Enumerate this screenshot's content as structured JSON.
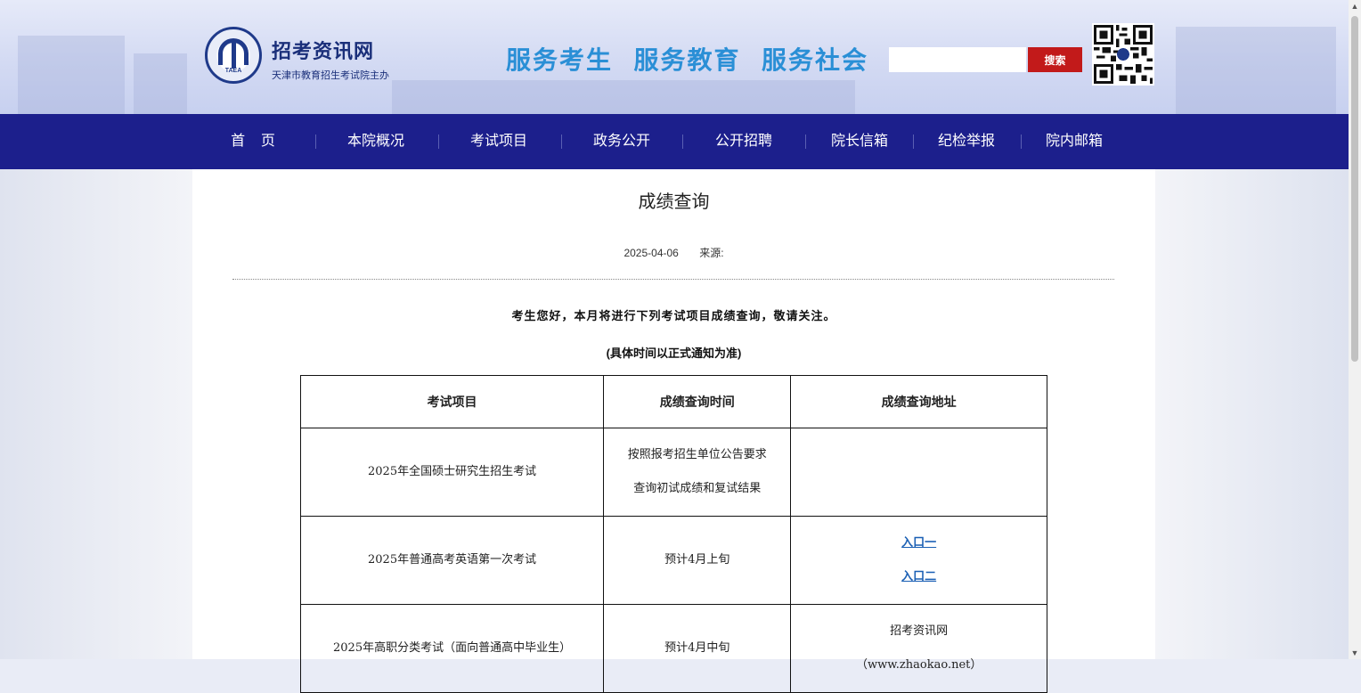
{
  "header": {
    "logo_text": "TAEA",
    "site_name": "招考资讯网",
    "site_subtitle": "天津市教育招生考试院主办",
    "slogan": "服务考生  服务教育  服务社会",
    "search": {
      "placeholder": "",
      "value": "",
      "button_label": "搜索"
    }
  },
  "nav": {
    "items": [
      {
        "label": "首    页"
      },
      {
        "label": "本院概况"
      },
      {
        "label": "考试项目"
      },
      {
        "label": "政务公开"
      },
      {
        "label": "公开招聘"
      },
      {
        "label": "院长信箱"
      },
      {
        "label": "纪检举报"
      },
      {
        "label": "院内邮箱"
      }
    ]
  },
  "article": {
    "title": "成绩查询",
    "date": "2025-04-06",
    "source_label": "来源:",
    "intro": "考生您好，本月将进行下列考试项目成绩查询，敬请关注。",
    "note": "(具体时间以正式通知为准)",
    "table": {
      "headers": [
        "考试项目",
        "成绩查询时间",
        "成绩查询地址"
      ],
      "rows": [
        {
          "project": "2025年全国硕士研究生招生考试",
          "time_line1": "按照报考招生单位公告要求",
          "time_line2": "查询初试成绩和复试结果"
        },
        {
          "project": "2025年普通高考英语第一次考试",
          "time_line1": "预计4月上旬",
          "link1": "入口一",
          "link2": "入口二"
        },
        {
          "project": "2025年高职分类考试（面向普通高中毕业生）",
          "time_line1": "预计4月中旬",
          "address_line1": "招考资讯网",
          "address_line2": "（www.zhaokao.net）"
        }
      ]
    }
  },
  "colors": {
    "nav_bg": "#1c1f8c",
    "search_button": "#c21a1a",
    "slogan": "#2a8fd6",
    "link": "#1a5fb4"
  }
}
